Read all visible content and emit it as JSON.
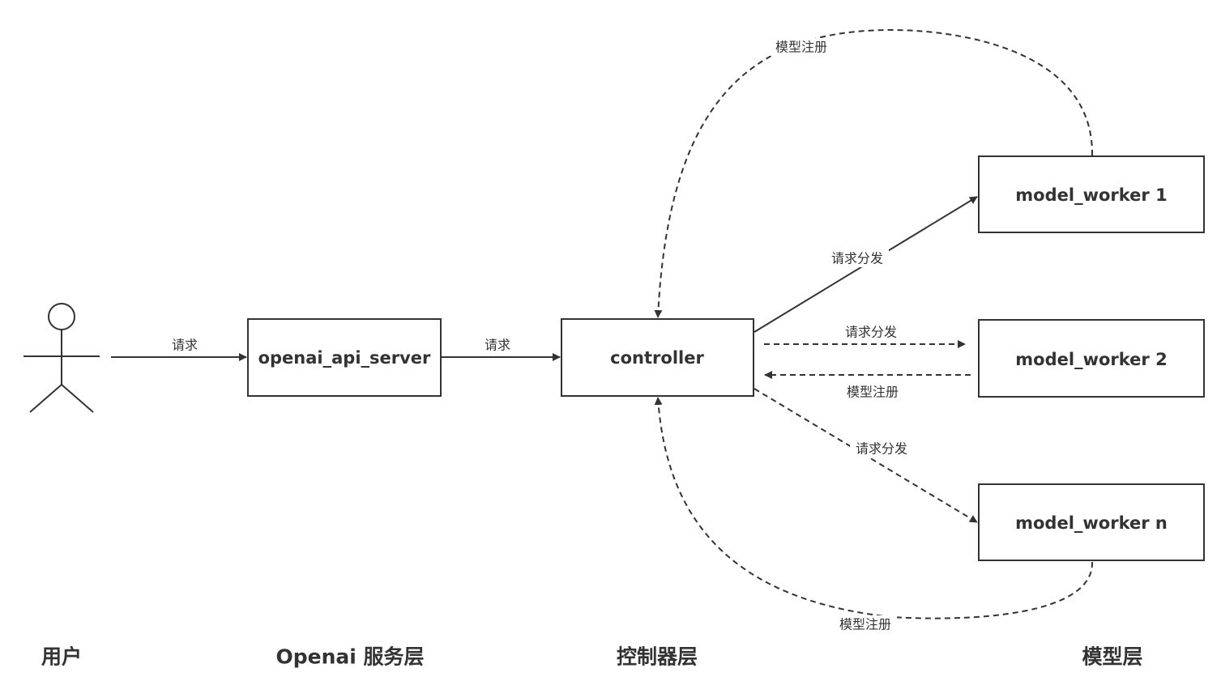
{
  "diagram": {
    "nodes": {
      "openai_api_server": "openai_api_server",
      "controller": "controller",
      "model_worker_1": "model_worker 1",
      "model_worker_2": "model_worker 2",
      "model_worker_n": "model_worker n"
    },
    "edges": {
      "user_to_server": "请求",
      "server_to_controller": "请求",
      "dispatch_worker_1": "请求分发",
      "dispatch_worker_2": "请求分发",
      "register_worker_2": "模型注册",
      "dispatch_worker_n": "请求分发",
      "register_worker_1": "模型注册",
      "register_worker_n": "模型注册"
    },
    "layers": {
      "user": "用户",
      "service": "Openai 服务层",
      "controller": "控制器层",
      "model": "模型层"
    },
    "colors": {
      "stroke": "#333333",
      "background": "#ffffff"
    }
  }
}
